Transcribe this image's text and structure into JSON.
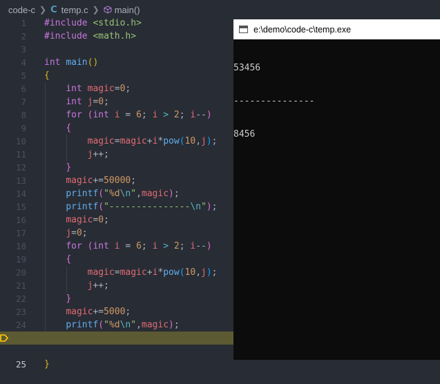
{
  "breadcrumb": {
    "folder": "code-c",
    "file": "temp.c",
    "file_icon_text": "C",
    "symbol": "main()",
    "symbol_icon": "cube-icon"
  },
  "editor": {
    "current_line": 25,
    "breakpoint_line": 25,
    "lines": [
      {
        "n": "1"
      },
      {
        "n": "2"
      },
      {
        "n": "3"
      },
      {
        "n": "4"
      },
      {
        "n": "5"
      },
      {
        "n": "6"
      },
      {
        "n": "7"
      },
      {
        "n": "8"
      },
      {
        "n": "9"
      },
      {
        "n": "10"
      },
      {
        "n": "11"
      },
      {
        "n": "12"
      },
      {
        "n": "13"
      },
      {
        "n": "14"
      },
      {
        "n": "15"
      },
      {
        "n": "16"
      },
      {
        "n": "17"
      },
      {
        "n": "18"
      },
      {
        "n": "19"
      },
      {
        "n": "20"
      },
      {
        "n": "21"
      },
      {
        "n": "22"
      },
      {
        "n": "23"
      },
      {
        "n": "24"
      },
      {
        "n": "25"
      }
    ]
  },
  "console": {
    "title": "e:\\demo\\code-c\\temp.exe",
    "output": [
      "53456",
      "---------------",
      "8456"
    ]
  },
  "colors": {
    "keyword": "#c678dd",
    "function": "#61afef",
    "string": "#98c379",
    "number": "#d19a66",
    "variable": "#e06c75",
    "current_line_bg": "#5c5a33",
    "console_bg": "#0c0c0c"
  }
}
